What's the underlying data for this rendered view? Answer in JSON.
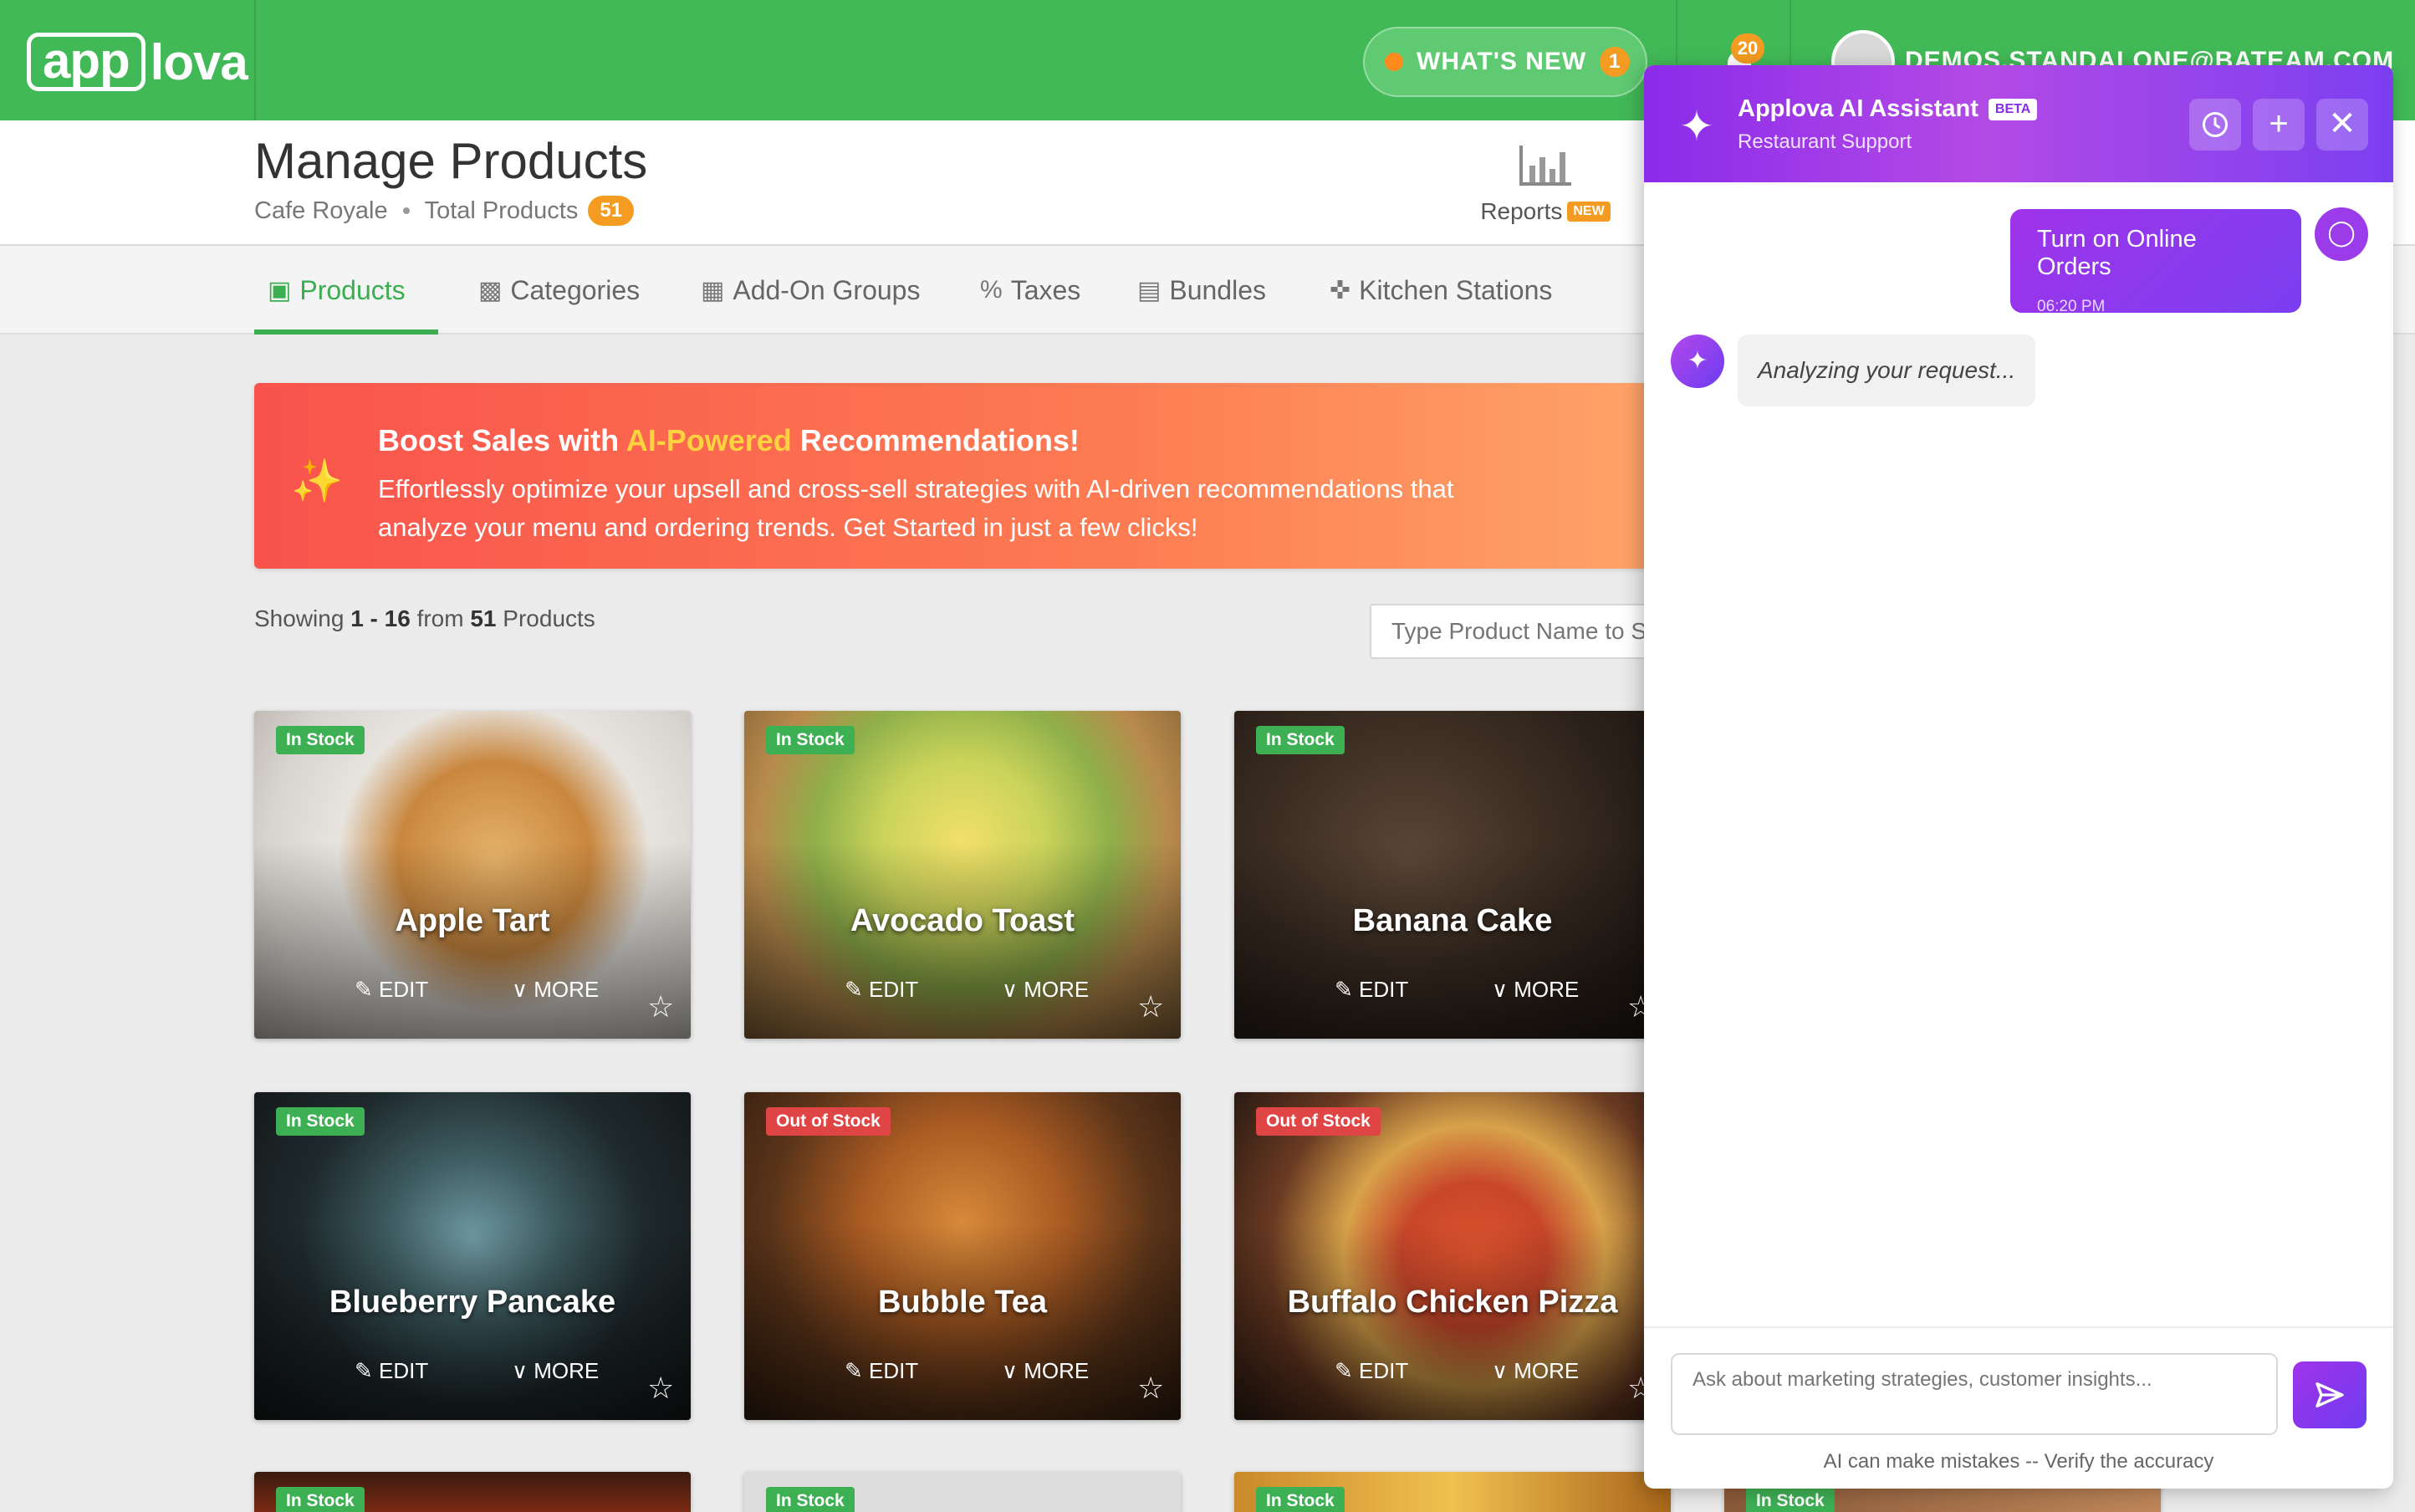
{
  "topbar": {
    "logo_part1": "app",
    "logo_part2": "lova",
    "whats_new_label": "WHAT'S NEW",
    "whats_new_count": "1",
    "notification_count": "20",
    "user_email": "DEMOS.STANDALONE@BATEAM.COM"
  },
  "header": {
    "title": "Manage Products",
    "location": "Cafe Royale",
    "total_label": "Total Products",
    "total_count": "51",
    "reports_label": "Reports",
    "reports_badge": "NEW"
  },
  "tabs": [
    {
      "label": "Products",
      "active": true
    },
    {
      "label": "Categories"
    },
    {
      "label": "Add-On Groups"
    },
    {
      "label": "Taxes"
    },
    {
      "label": "Bundles"
    },
    {
      "label": "Kitchen Stations"
    }
  ],
  "banner": {
    "title_pre": "Boost Sales with ",
    "title_highlight": "AI-Powered",
    "title_post": " Recommendations!",
    "text": "Effortlessly optimize your upsell and cross-sell strategies with AI-driven recommendations that analyze your menu and ordering trends. Get Started in just a few clicks!"
  },
  "listing": {
    "showing_pre": "Showing ",
    "range": "1 - 16",
    "from": " from ",
    "total": "51",
    "suffix": " Products",
    "search_placeholder": "Type Product Name to Search"
  },
  "card_labels": {
    "edit": "EDIT",
    "more": "MORE"
  },
  "products": [
    {
      "name": "Apple Tart",
      "stock": "In Stock"
    },
    {
      "name": "Avocado Toast",
      "stock": "In Stock"
    },
    {
      "name": "Banana Cake",
      "stock": "In Stock"
    },
    {
      "name": "Blueberry Pancake",
      "stock": "In Stock"
    },
    {
      "name": "Bubble Tea",
      "stock": "Out of Stock"
    },
    {
      "name": "Buffalo Chicken Pizza",
      "stock": "Out of Stock"
    },
    {
      "name": "",
      "stock": "In Stock"
    },
    {
      "name": "",
      "stock": "In Stock"
    },
    {
      "name": "",
      "stock": "In Stock"
    },
    {
      "name": "",
      "stock": "In Stock"
    }
  ],
  "chat": {
    "title": "Applova AI Assistant",
    "beta": "BETA",
    "subtitle": "Restaurant Support",
    "user_message": "Turn on Online Orders",
    "user_time": "06:20 PM",
    "bot_message": "Analyzing your request...",
    "input_placeholder": "Ask about marketing strategies, customer insights...",
    "disclaimer": "AI can make mistakes -- Verify the accuracy"
  },
  "colors": {
    "brand_green": "#42b957",
    "accent_orange": "#f39c21",
    "assistant_purple": "#8b2bea",
    "in_stock": "#3db054",
    "out_of_stock": "#e04545"
  }
}
